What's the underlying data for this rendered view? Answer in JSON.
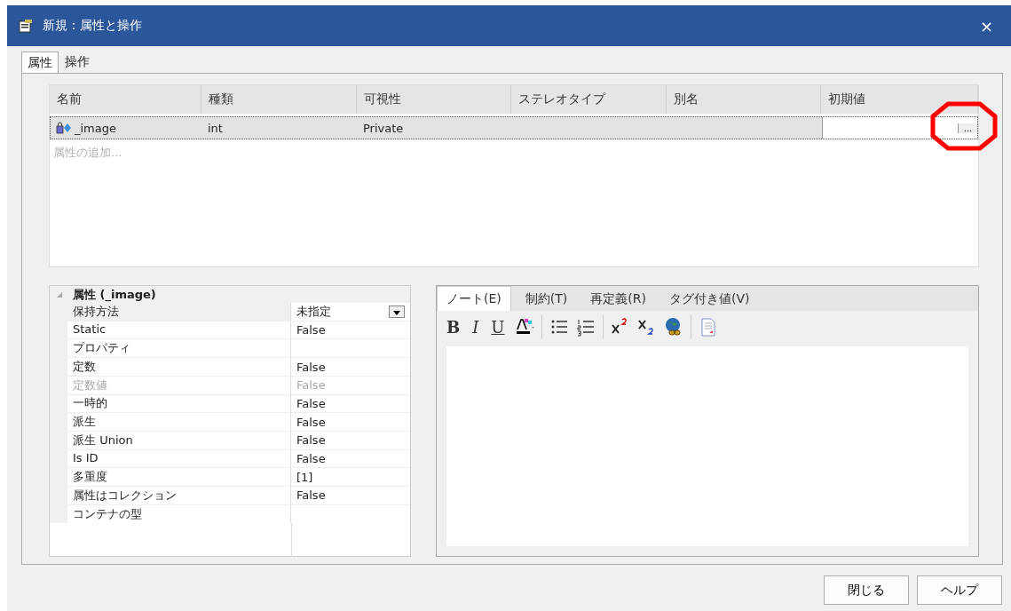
{
  "window": {
    "title": "新規：属性と操作",
    "close": "×"
  },
  "tabs": [
    {
      "label": "属性",
      "selected": true
    },
    {
      "label": "操作",
      "selected": false
    }
  ],
  "attributes": {
    "columns": [
      "名前",
      "種類",
      "可視性",
      "ステレオタイプ",
      "別名",
      "初期値"
    ],
    "rows": [
      {
        "name": "_image",
        "type": "int",
        "visibility": "Private",
        "stereotype": "",
        "alias": "",
        "initial_value": "",
        "selected": true,
        "editing": true,
        "button": "..."
      }
    ],
    "placeholder": "属性の追加..."
  },
  "properties": {
    "title": "属性 (_image)",
    "expanded": true,
    "rows": [
      {
        "label": "保持方法",
        "value": "未指定",
        "kind": "dropdown",
        "disabled": false
      },
      {
        "label": "Static",
        "value": "False",
        "kind": "text",
        "disabled": false
      },
      {
        "label": "プロパティ",
        "value": "",
        "kind": "text",
        "disabled": false
      },
      {
        "label": "定数",
        "value": "False",
        "kind": "text",
        "disabled": false
      },
      {
        "label": "定数値",
        "value": "False",
        "kind": "text",
        "disabled": true
      },
      {
        "label": "一時的",
        "value": "False",
        "kind": "text",
        "disabled": false
      },
      {
        "label": "派生",
        "value": "False",
        "kind": "text",
        "disabled": false
      },
      {
        "label": "派生 Union",
        "value": "False",
        "kind": "text",
        "disabled": false
      },
      {
        "label": "Is ID",
        "value": "False",
        "kind": "text",
        "disabled": false
      },
      {
        "label": "多重度",
        "value": "[1]",
        "kind": "text",
        "disabled": false
      },
      {
        "label": "属性はコレクション",
        "value": "False",
        "kind": "text",
        "disabled": false
      },
      {
        "label": "コンテナの型",
        "value": "",
        "kind": "text",
        "disabled": false
      }
    ]
  },
  "notes": {
    "tabs": [
      {
        "label": "ノート(E)",
        "selected": true
      },
      {
        "label": "制約(T)",
        "selected": false
      },
      {
        "label": "再定義(R)",
        "selected": false
      },
      {
        "label": "タグ付き値(V)",
        "selected": false
      }
    ],
    "toolbar": [
      {
        "kind": "bold",
        "label": "B"
      },
      {
        "kind": "italic",
        "label": "I"
      },
      {
        "kind": "underline",
        "label": "U"
      },
      {
        "kind": "color"
      },
      {
        "kind": "sep"
      },
      {
        "kind": "bullets"
      },
      {
        "kind": "numbers"
      },
      {
        "kind": "sep"
      },
      {
        "kind": "superscript"
      },
      {
        "kind": "subscript"
      },
      {
        "kind": "link"
      },
      {
        "kind": "sep"
      },
      {
        "kind": "document"
      }
    ]
  },
  "buttons": [
    "閉じる",
    "ヘルプ"
  ]
}
